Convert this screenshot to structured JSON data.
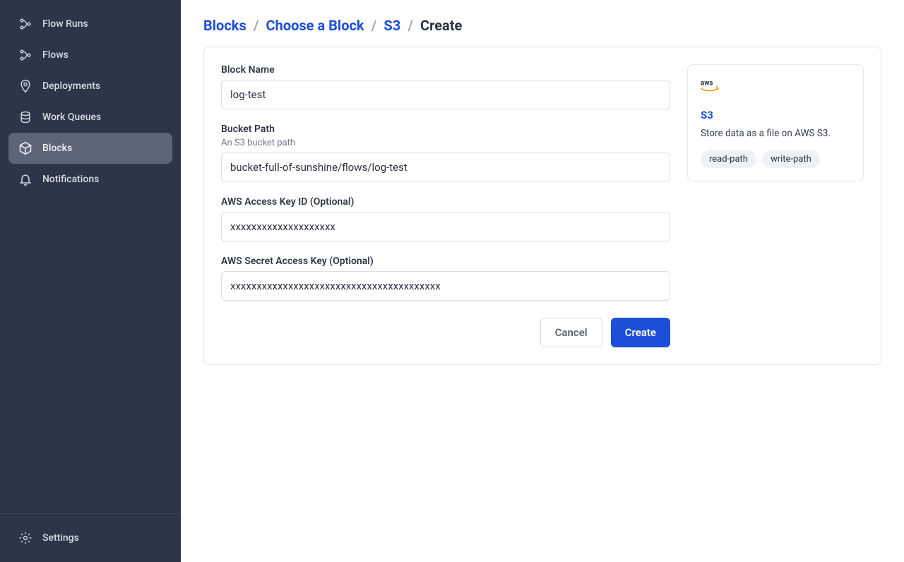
{
  "sidebar": {
    "items": [
      {
        "label": "Flow Runs"
      },
      {
        "label": "Flows"
      },
      {
        "label": "Deployments"
      },
      {
        "label": "Work Queues"
      },
      {
        "label": "Blocks"
      },
      {
        "label": "Notifications"
      }
    ],
    "settings_label": "Settings"
  },
  "breadcrumb": {
    "blocks": "Blocks",
    "choose": "Choose a Block",
    "s3": "S3",
    "create": "Create"
  },
  "form": {
    "block_name_label": "Block Name",
    "block_name_value": "log-test",
    "bucket_path_label": "Bucket Path",
    "bucket_path_help": "An S3 bucket path",
    "bucket_path_value": "bucket-full-of-sunshine/flows/log-test",
    "access_key_label": "AWS Access Key ID (Optional)",
    "access_key_value": "xxxxxxxxxxxxxxxxxxxx",
    "secret_key_label": "AWS Secret Access Key (Optional)",
    "secret_key_value": "xxxxxxxxxxxxxxxxxxxxxxxxxxxxxxxxxxxxxxxx",
    "cancel_label": "Cancel",
    "create_label": "Create"
  },
  "info": {
    "title": "S3",
    "desc": "Store data as a file on AWS S3.",
    "tags": [
      "read-path",
      "write-path"
    ]
  }
}
